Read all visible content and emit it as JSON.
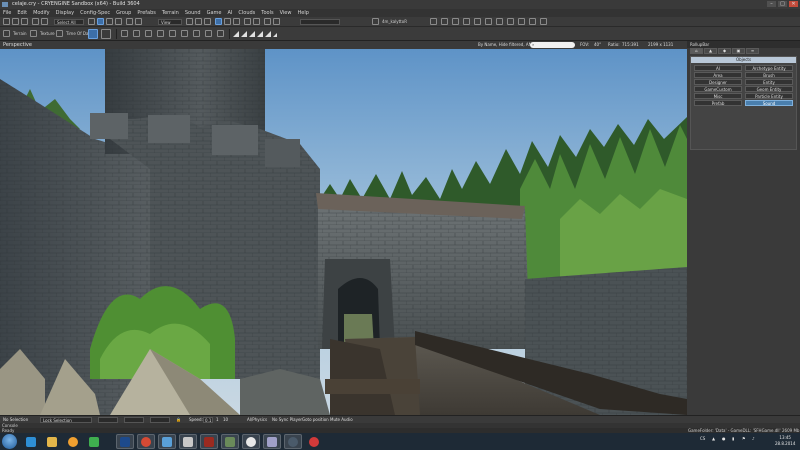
{
  "window": {
    "title": "celaje.cry - CRYENGINE Sandbox (x64) - Build 3604"
  },
  "menubar": [
    "File",
    "Edit",
    "Modify",
    "Display",
    "Config-Spec",
    "Group",
    "Prefabs",
    "Terrain",
    "Sound",
    "Game",
    "AI",
    "Clouds",
    "Tools",
    "View",
    "Help"
  ],
  "toolbar": {
    "select_all": "Select All",
    "view_combo": "View",
    "layer_name": "4m_kalyttoR",
    "terrain_label": "Terrain",
    "texture_label": "Texture",
    "time_of_day_label": "Time Of Day"
  },
  "viewport_header": {
    "label": "Perspective",
    "filter": "By Name, Hide filtered, AND",
    "fov_label": "FOV:",
    "fov_value": "40°",
    "ratio_label": "Ratio:",
    "ratio_value": "715:391",
    "resolution": "2199 x 1131"
  },
  "rollup": {
    "header": "RollupBar",
    "tab_icons": [
      "objects-tab",
      "terrain-tab",
      "modelling-tab",
      "display-tab",
      "layers-tab"
    ],
    "group_title": "Objects",
    "buttons": [
      [
        "AI",
        "Archetype Entity"
      ],
      [
        "Area",
        "Brush"
      ],
      [
        "Designer",
        "Entity"
      ],
      [
        "GameCustom",
        "Geom Entity"
      ],
      [
        "Misc",
        "Particle Entity"
      ],
      [
        "Prefab",
        "Sound"
      ]
    ],
    "selected_button": "Sound"
  },
  "bottombar": {
    "selection": "No Selection",
    "lock_selection": "Lock Selection",
    "speed_label": "Speed:",
    "speed_value": "0.1",
    "speed_options": [
      "0.1",
      "1",
      "10"
    ],
    "ai_physics": "AI/Physics",
    "no_sync": "No Sync Player",
    "goto_position": "Goto position",
    "mute_audio": "Mute Audio"
  },
  "status": {
    "console": "Console",
    "ready": "Ready",
    "gamefolder": "GameFolder: 'Data' - GameDLL: 'SFHGame.dll'",
    "memory": "2609 Mb"
  },
  "taskbar": {
    "apps": [
      "explorer",
      "media-player",
      "photoshop",
      "chrome",
      "aqua",
      "cryengine",
      "dota",
      "file-manager",
      "eye",
      "itunes",
      "steam",
      "opera"
    ],
    "tray_lang": "CS",
    "time": "13:45",
    "date": "28.8.2014"
  }
}
